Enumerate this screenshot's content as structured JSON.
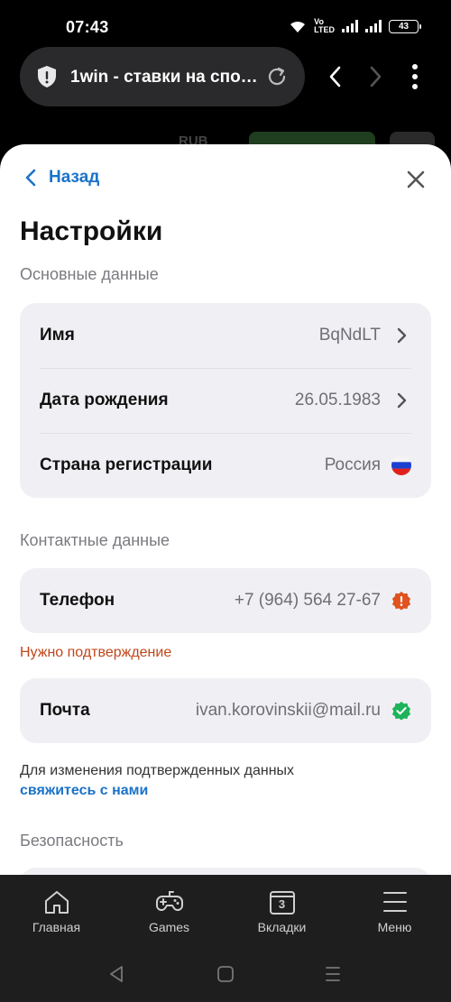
{
  "status": {
    "time": "07:43",
    "battery": "43",
    "volte_top": "Vo",
    "volte_bottom": "LTED"
  },
  "browser": {
    "url_title": "1win - ставки на спо…"
  },
  "underlying": {
    "currency": "RUB"
  },
  "sheet": {
    "back_label": "Назад",
    "title": "Настройки",
    "sections": {
      "basic": "Основные данные",
      "contact": "Контактные данные",
      "security": "Безопасность"
    },
    "basic_rows": [
      {
        "label": "Имя",
        "value": "BqNdLT"
      },
      {
        "label": "Дата рождения",
        "value": "26.05.1983"
      },
      {
        "label": "Страна регистрации",
        "value": "Россия"
      }
    ],
    "phone": {
      "label": "Телефон",
      "value": "+7 (964) 564 27-67"
    },
    "phone_warning": "Нужно подтверждение",
    "email": {
      "label": "Почта",
      "value": "ivan.korovinskii@mail.ru"
    },
    "note_text": "Для изменения подтвержденных данных",
    "note_link": "свяжитесь с нами"
  },
  "bottom_nav": {
    "home": "Главная",
    "games": "Games",
    "tabs": "Вкладки",
    "tabs_count": "3",
    "menu": "Меню"
  },
  "colors": {
    "accent": "#1a73c9",
    "warning": "#e0521f",
    "success": "#1eb35a",
    "card_bg": "#f0f0f4"
  }
}
